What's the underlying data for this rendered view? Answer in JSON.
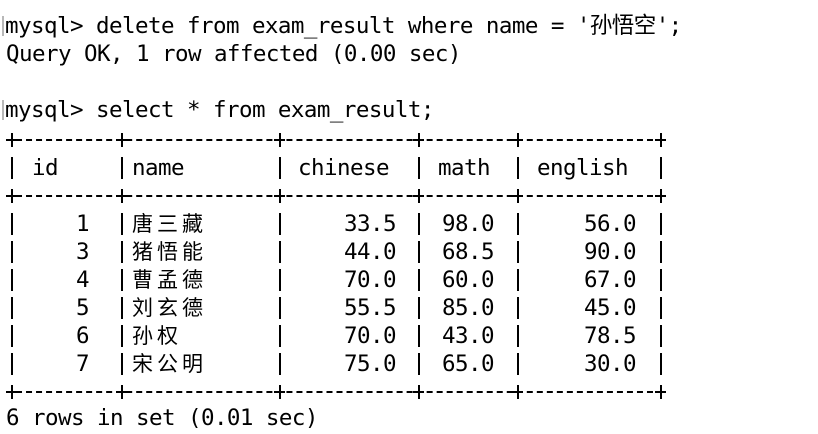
{
  "terminal": {
    "lines": [
      {
        "prompt": "mysql> ",
        "command": "delete from exam_result where name = '孙悟空';"
      },
      {
        "output": "Query OK, 1 row affected (0.00 sec)"
      },
      {
        "prompt": "mysql> ",
        "command": "select * from exam_result;"
      }
    ],
    "footer": "6 rows in set (0.01 sec)"
  },
  "table": {
    "columns": [
      "id",
      "name",
      "chinese",
      "math",
      "english"
    ],
    "rows": [
      {
        "id": "1",
        "name": "唐三藏",
        "chinese": "33.5",
        "math": "98.0",
        "english": "56.0"
      },
      {
        "id": "3",
        "name": "猪悟能",
        "chinese": "44.0",
        "math": "68.5",
        "english": "90.0"
      },
      {
        "id": "4",
        "name": "曹孟德",
        "chinese": "70.0",
        "math": "60.0",
        "english": "67.0"
      },
      {
        "id": "5",
        "name": "刘玄德",
        "chinese": "55.5",
        "math": "85.0",
        "english": "45.0"
      },
      {
        "id": "6",
        "name": "孙权",
        "chinese": "70.0",
        "math": "43.0",
        "english": "78.5"
      },
      {
        "id": "7",
        "name": "宋公明",
        "chinese": "75.0",
        "math": "65.0",
        "english": "30.0"
      }
    ]
  }
}
